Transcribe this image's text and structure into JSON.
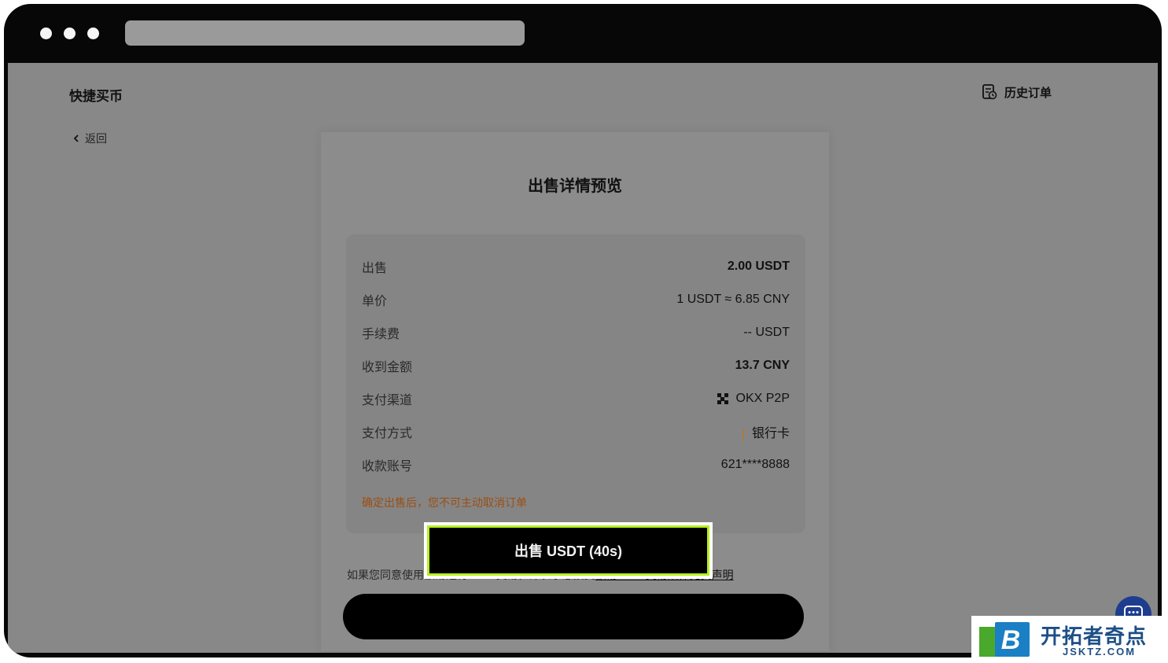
{
  "header": {
    "title": "快捷买币",
    "history_label": "历史订单",
    "back_label": "返回"
  },
  "card": {
    "title": "出售详情预览",
    "rows": [
      {
        "label": "出售",
        "value": "2.00 USDT"
      },
      {
        "label": "单价",
        "value": "1 USDT ≈ 6.85 CNY"
      },
      {
        "label": "手续费",
        "value": "-- USDT"
      },
      {
        "label": "收到金额",
        "value": "13.7 CNY"
      },
      {
        "label": "支付渠道",
        "value": "OKX P2P"
      },
      {
        "label": "支付方式",
        "value": "银行卡"
      },
      {
        "label": "收款账号",
        "value": "621****8888"
      }
    ],
    "warning": "确定出售后，您不可主动取消订单",
    "agree_text": "如果您同意使用欧易进行 C2C 交易，即表示您接受",
    "agree_link": "欧易 C2C 交易法律免责声明",
    "sell_button": "出售 USDT (40s)"
  },
  "watermark": {
    "logo_letter": "B",
    "cn": "开拓者奇点",
    "en": "JSKTZ.COM"
  },
  "colors": {
    "highlight": "#b7ee20",
    "warning": "#9a4f14",
    "chat": "#1e3d8f"
  }
}
